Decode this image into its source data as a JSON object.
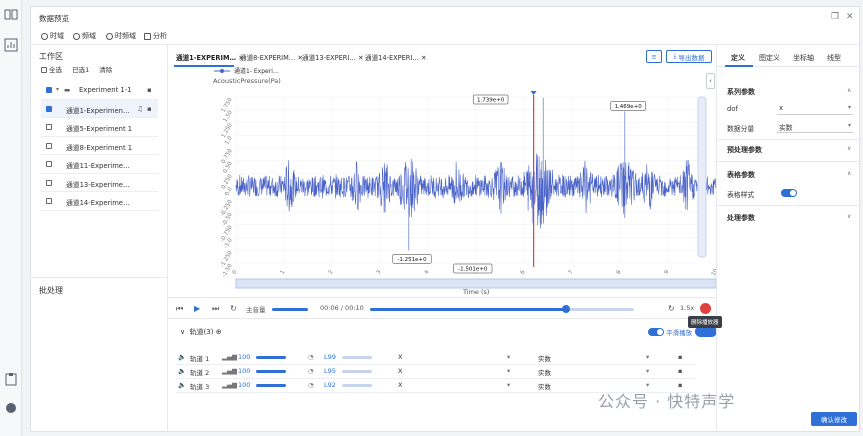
{
  "window": {
    "title": "数据预览"
  },
  "toolbar": {
    "items": [
      "时域",
      "频域",
      "时频域",
      "分析"
    ]
  },
  "left_panel": {
    "workspace_title": "工作区",
    "select_all": "全选",
    "selected": "已选1",
    "clear": "清除",
    "tree": [
      "Experiment 1-1",
      "通道1-Experimen…",
      "通道5-Experiment 1",
      "通道8-Experiment 1",
      "通道11-Experime…",
      "通道13-Experime…",
      "通道14-Experime…"
    ],
    "postprocess_title": "批处理"
  },
  "center": {
    "tabs": [
      "通道1-EXPERIM…",
      "通道8-EXPERIM…",
      "通道13-EXPERI…",
      "通道14-EXPERI…"
    ],
    "export_label": "导出数据",
    "legend_label": "通道1- Experi…",
    "ylabel": "AcousticPressure(Pa)",
    "xlabel": "Time (s)",
    "annotations": {
      "max": "1.739e+0",
      "peak2": "1.469e+0",
      "min1": "-1.251e+0",
      "min2": "-1.501e+0"
    },
    "player": {
      "volume_label": "主音量",
      "time": "00:06 / 00:10",
      "speed": "1.5x"
    },
    "tracks": {
      "title": "轨道(3)",
      "smooth_label": "平滑播放",
      "tooltip": "删除播放器",
      "rows": [
        {
          "name": "轨道 1",
          "gain": "100",
          "lvl": "L99",
          "axis": "X",
          "type": "实数"
        },
        {
          "name": "轨道 2",
          "gain": "100",
          "lvl": "L95",
          "axis": "X",
          "type": "实数"
        },
        {
          "name": "轨道 3",
          "gain": "100",
          "lvl": "L92",
          "axis": "X",
          "type": "实数"
        }
      ]
    }
  },
  "right_panel": {
    "tabs": [
      "定义",
      "图定义",
      "坐标轴",
      "线型"
    ],
    "series_params": "系列参数",
    "dof_label": "dof",
    "dof_value": "x",
    "component_label": "数据分量",
    "component_value": "实数",
    "preproc": "预处理参数",
    "table_params": "表格参数",
    "table_style_label": "表格样式",
    "process_params": "处理参数",
    "confirm": "确认修改"
  },
  "watermark": "公众号 · 快特声学",
  "chart_data": {
    "type": "line",
    "title": "",
    "xlabel": "Time (s)",
    "ylabel": "AcousticPressure(Pa)",
    "xlim": [
      0,
      10
    ],
    "ylim": [
      -1.5,
      1.75
    ],
    "xticks": [
      0,
      1,
      2,
      3,
      4,
      5,
      6,
      7,
      8,
      9,
      10
    ],
    "yticks": [
      -1.5,
      -1.25,
      -1.0,
      -0.75,
      -0.5,
      -0.25,
      0.0,
      0.25,
      0.5,
      0.75,
      1.0,
      1.25,
      1.5,
      1.75
    ],
    "cursor_x": 6.2,
    "series": [
      {
        "name": "通道1- Experi…",
        "color": "#4a63c9"
      }
    ],
    "peaks": [
      {
        "x": 6.4,
        "y": 1.739
      },
      {
        "x": 8.1,
        "y": 1.469
      },
      {
        "x": 3.6,
        "y": -1.251
      },
      {
        "x": 6.2,
        "y": -1.501
      }
    ]
  }
}
